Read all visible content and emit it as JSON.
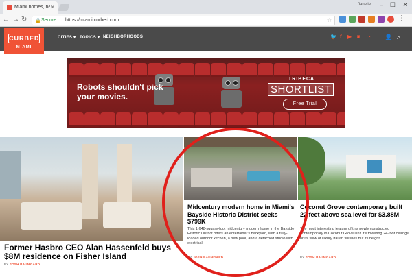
{
  "browser": {
    "tab_title": "Miami homes, neighborhoods",
    "url_prefix": "Secure",
    "url": "https://miami.curbed.com",
    "window_user": "Janelle"
  },
  "site": {
    "brand": "CURBED",
    "city": "MIAMI",
    "nav": [
      {
        "label": "CITIES",
        "icon": "chevron-down-icon"
      },
      {
        "label": "TOPICS",
        "icon": "chevron-down-icon"
      },
      {
        "label": "NEIGHBORHOODS"
      }
    ],
    "social_icons": [
      "twitter-icon",
      "facebook-icon",
      "youtube-icon",
      "instagram-icon",
      "rss-icon"
    ],
    "accent_color": "#f05336"
  },
  "ad": {
    "headline": "Robots shouldn't pick your movies.",
    "brand_top": "TRIBECA",
    "brand_main": "SHORTLIST",
    "cta": "Free Trial"
  },
  "stories": [
    {
      "headline": "Former Hasbro CEO Alan Hassenfeld buys $8M residence on Fisher Island",
      "by": "BY",
      "author": "JOSH BAUMGARD"
    },
    {
      "headline": "Midcentury modern home in Miami's Bayside Historic District seeks $799K",
      "dek": "This 1,648-square-foot midcentury modern home in the Bayside Historic District offers an entertainer's backyard, with a fully-loaded outdoor kitchen, a new pool, and a detached studio with electrical.",
      "by": "BY",
      "author": "JOSH BAUMGARD"
    },
    {
      "headline": "Coconut Grove contemporary built 22 feet above sea level for $3.88M",
      "dek": "The most interesting feature of this newly constructed contemporary in Coconut Grove isn't it's towering 24-foot ceilings or its slew of luxury Italian finishes but its height.",
      "by": "BY",
      "author": "JOSH BAUMGARD"
    }
  ],
  "annotation_color": "#e0201b"
}
